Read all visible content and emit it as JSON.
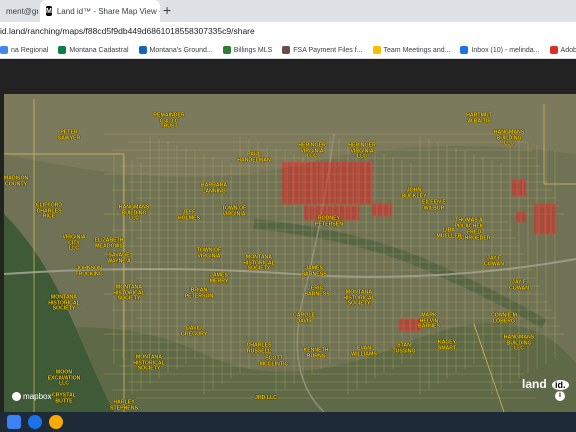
{
  "browser": {
    "tabs": [
      {
        "label": "ment@gr",
        "close": "✕"
      },
      {
        "label": "Land id™ - Share Map View - ",
        "close": "✕"
      }
    ],
    "new_tab": "+",
    "url": "id.land/ranching/maps/f88cd5f9db449d6861018558307335c9/share",
    "bookmarks": [
      "na Regional",
      "Montana Cadastral",
      "Montana's Ground...",
      "Billings MLS",
      "FSA Payment Files f...",
      "Team Meetings and...",
      "Inbox (10) - melinda...",
      "Adobe Acrobat"
    ]
  },
  "map": {
    "labels": [
      "PETER\nSAWYER",
      "REMAINDER\nG & J C\nTRUST",
      "HARTMUT\nW BAITIS",
      "HANGMANS\nBUILDING\nLLC",
      "MADISON\nCOUNTY",
      "HERINGER\nVIRGINIA\nLLC",
      "HERINGER\nVIRGINIA\nLLC",
      "PAUL\nHANDELMAN",
      "BARBARA\nLANNING",
      "TOWN OF\nVIRGINIA",
      "CLIFFORD\nCHARLES\nRICE",
      "HANGMANS\nBUILDING\nLLC",
      "JEFF\nHOLMES",
      "RODNEY\nPETERSEN",
      "VIRGINIA\nCITY\nLLC",
      "ELIZABETH\nMEADOWS",
      "SAVAGE\nWAYNE A",
      "TOWN OF\nVIRGINIA",
      "JOHNSON\nTRUCKING",
      "MONTANA\nHISTORICAL\nSOCIETY",
      "MONTANA\nHISTORICAL\nSOCIETY",
      "JAMES\nMERRY",
      "BRIAN\nPETERSON",
      "MONTANA\nHISTORICAL\nSOCIETY",
      "JAMES\nBARNESS",
      "ERIC\nBARNESS",
      "MONTANA\nHISTORICAL\nSOCIETY",
      "THOMAS A\nPOLACHEK",
      "JAY F\nCOWAN",
      "JAY F\nCOWAN",
      "CONNIE M\nLOBERG",
      "HANGMANS\nBUILDING\nLLC",
      "MARK\nHELVIN\nBARNES",
      "KACEY\nSMART",
      "STAN\nTUSSING",
      "SCOTT\nMCCLINTIC",
      "CHARLES\nRUSSELL",
      "DAVID\nGREGORY",
      "MONTANA\nHISTORICAL\nSOCIETY",
      "MOON\nEXCAVATION\nLLC",
      "HARLEY\nSTEPHENS",
      "CRYSTAL\nBUTTE",
      "JHD LLC",
      "KENNETH\nBURNS",
      "EVAN\nWILLIAMS",
      "FRED\nSCHROEDER",
      "JOHN\nBUCKLEY",
      "EILEEN E\nWILBUR",
      "CAROLE\nDAVIS",
      "LIBA\nMUELLER"
    ],
    "attribution": "mapbox",
    "brand": "land",
    "brand_badge": "id.",
    "info": "i"
  }
}
